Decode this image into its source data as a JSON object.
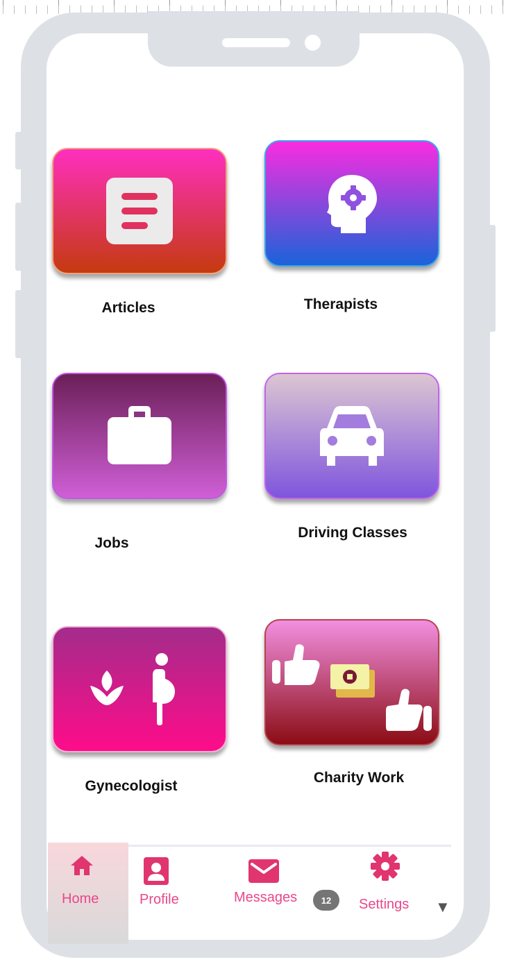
{
  "tiles": [
    {
      "id": "articles",
      "label": "Articles",
      "icon": "article-icon"
    },
    {
      "id": "therapists",
      "label": "Therapists",
      "icon": "head-gear-icon"
    },
    {
      "id": "jobs",
      "label": "Jobs",
      "icon": "briefcase-icon"
    },
    {
      "id": "driving",
      "label": "Driving Classes",
      "icon": "car-icon"
    },
    {
      "id": "gynecologist",
      "label": "Gynecologist",
      "icon": "pregnancy-lotus-icon"
    },
    {
      "id": "charity",
      "label": "Charity Work",
      "icon": "thumbs-money-icon"
    }
  ],
  "tabbar": {
    "home": {
      "label": "Home",
      "icon": "home-icon",
      "active": true
    },
    "profile": {
      "label": "Profile",
      "icon": "profile-icon"
    },
    "messages": {
      "label": "Messages",
      "icon": "envelope-icon",
      "badge": "12"
    },
    "settings": {
      "label": "Settings",
      "icon": "gear-icon"
    },
    "more": {
      "icon": "chevron-down-icon",
      "glyph": "▼"
    }
  },
  "colors": {
    "accent": "#e8478b",
    "device_frame": "#dde1e6",
    "badge": "#757575"
  }
}
